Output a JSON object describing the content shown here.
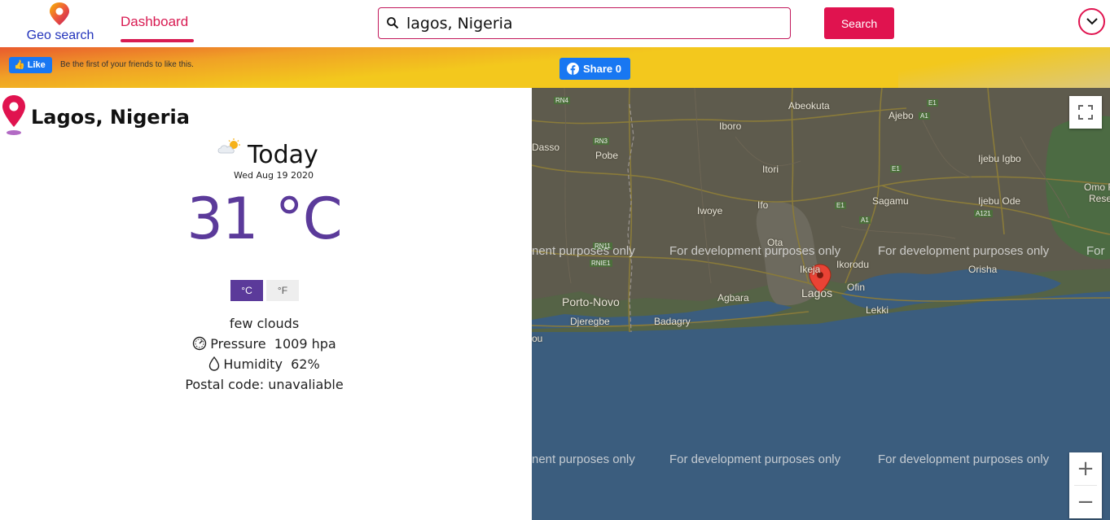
{
  "header": {
    "logo_text": "Geo search",
    "nav_tab": "Dashboard",
    "search": {
      "value": "lagos, Nigeria",
      "placeholder": ""
    },
    "search_button": "Search"
  },
  "social": {
    "like_button": "Like",
    "like_text": "Be the first of your friends to like this.",
    "share_button": "Share 0"
  },
  "weather": {
    "location": "Lagos, Nigeria",
    "day_label": "Today",
    "date": "Wed Aug 19 2020",
    "temperature": "31 °C",
    "unit_c": "°C",
    "unit_f": "°F",
    "description": "few clouds",
    "pressure_label": "Pressure",
    "pressure_value": "1009 hpa",
    "humidity_label": "Humidity",
    "humidity_value": "62%",
    "postal_code": "Postal code: unavaliable"
  },
  "map": {
    "places": [
      "Abeokuta",
      "Ajebo",
      "Iboro",
      "Dasso",
      "Pobe",
      "Ijebu Igbo",
      "Itori",
      "Ifo",
      "Sagamu",
      "Ijebu Ode",
      "Iwoye",
      "Omo Fo",
      "Rese",
      "Ota",
      "Ikorodu",
      "Ikeja",
      "Orisha",
      "Porto-Novo",
      "Agbara",
      "Lagos",
      "Ofin",
      "Lekki",
      "Djeregbe",
      "Badagry",
      "ou"
    ],
    "roads": [
      "RN4",
      "RN3",
      "RN11",
      "RNIE1",
      "E1",
      "A1",
      "E1",
      "E1",
      "A1",
      "A121"
    ],
    "watermark": "For development purposes only",
    "watermark_partial": "nent purposes only",
    "watermark_edge": "For",
    "zoom_in": "+",
    "zoom_out": "−"
  },
  "colors": {
    "accent": "#e0134f",
    "brand_blue": "#2233bb",
    "temp_purple": "#5b3a9a",
    "facebook": "#1877f2"
  }
}
